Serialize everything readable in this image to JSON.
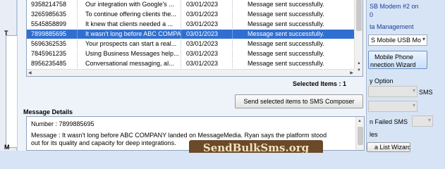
{
  "left_panel": {
    "label_top": "T",
    "label_bottom": "M"
  },
  "grid": {
    "rows": [
      {
        "number": "9358214758",
        "message": "Our integration with Google's ...",
        "date": "03/01/2023",
        "status": "Message sent successfully.",
        "selected": false
      },
      {
        "number": "3265985635",
        "message": "To continue offering clients the...",
        "date": "03/01/2023",
        "status": "Message sent successfully.",
        "selected": false
      },
      {
        "number": "5545858899",
        "message": "It knew that clients needed a ...",
        "date": "03/01/2023",
        "status": "Message sent successfully.",
        "selected": false
      },
      {
        "number": "7899885695",
        "message": "It wasn't long before ABC COMPA...",
        "date": "03/01/2023",
        "status": "Message sent successfully.",
        "selected": true
      },
      {
        "number": "5696362535",
        "message": "Your prospects can start a real...",
        "date": "03/01/2023",
        "status": "Message sent successfully.",
        "selected": false
      },
      {
        "number": "7845961235",
        "message": "Using Business Messages help...",
        "date": "03/01/2023",
        "status": "Message sent successfully.",
        "selected": false
      },
      {
        "number": "8956235485",
        "message": "Conversational messaging, al...",
        "date": "03/01/2023",
        "status": "Message sent successfully.",
        "selected": false
      }
    ]
  },
  "selected_items_label": "Selected Items : 1",
  "send_button_label": "Send selected items to SMS Composer",
  "details": {
    "title": "Message Details",
    "number_line": "Number  :  7899885695",
    "message_line_1": "Message  :  It wasn't long before ABC COMPANY landed on MessageMedia. Ryan says the platform stood",
    "message_line_2": "out for its quality and capacity for deep integrations."
  },
  "watermark_text": "SendBulkSms.org",
  "right_panel": {
    "modem_text_1": "SB Modem #2 on",
    "modem_text_2": "0",
    "data_management_link": "ta Management",
    "device_select_value": "S Mobile USB Mo",
    "connection_button_line1": "Mobile Phone",
    "connection_button_line2": "nnection  Wizard",
    "option_label": "y Option",
    "sms_label": "SMS",
    "failed_sms_label": "n Failed SMS",
    "les_label": "les",
    "list_wizard_label": "a List Wizard"
  }
}
